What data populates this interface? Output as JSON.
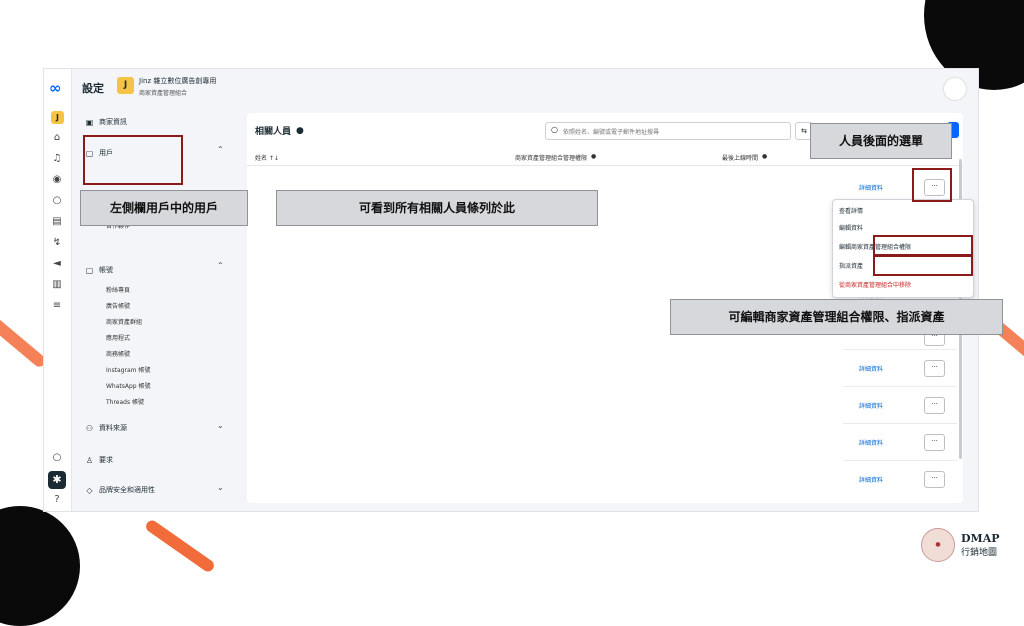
{
  "app": {
    "title": "設定"
  },
  "business": {
    "avatar": "J",
    "name": "Jinz 雜立數位廣告創專用",
    "subtitle": "商家資產管理組合"
  },
  "rail": {
    "avatar": "J"
  },
  "sidebar": {
    "business_info": "商家資訊",
    "users_section": "用戶",
    "users_sub": [
      "用戶",
      "合作夥伴"
    ],
    "accounts_section": "帳號",
    "accounts_sub": [
      "粉絲專頁",
      "廣告帳號",
      "商家資產群組",
      "應用程式",
      "商務帳號",
      "Instagram 帳號",
      "WhatsApp 帳號",
      "Threads 帳號"
    ],
    "data_sources": "資料來源",
    "requests": "要求",
    "brand_safety": "品牌安全和適用性"
  },
  "panel": {
    "title": "相關人員",
    "search_placeholder": "依照姓名、編號或電子郵件地址搜尋",
    "col_name": "姓名 ↑↓",
    "col_access": "商家資產管理組合管理權限",
    "col_last": "最後上線時間",
    "row_link": "詳細資料",
    "row_more": "···"
  },
  "dropdown": [
    "查看詳情",
    "編輯資料",
    "編輯商家資產管理組合權限",
    "指派資產",
    "從商家資產管理組合中移除"
  ],
  "callouts": {
    "left": "左側欄用戶中的用戶",
    "middle": "可看到所有相關人員條列於此",
    "top_right": "人員後面的選單",
    "bottom_right": "可編輯商家資產管理組合權限、指派資產"
  },
  "brand": {
    "name": "DMAP",
    "tagline": "行銷地圖"
  }
}
